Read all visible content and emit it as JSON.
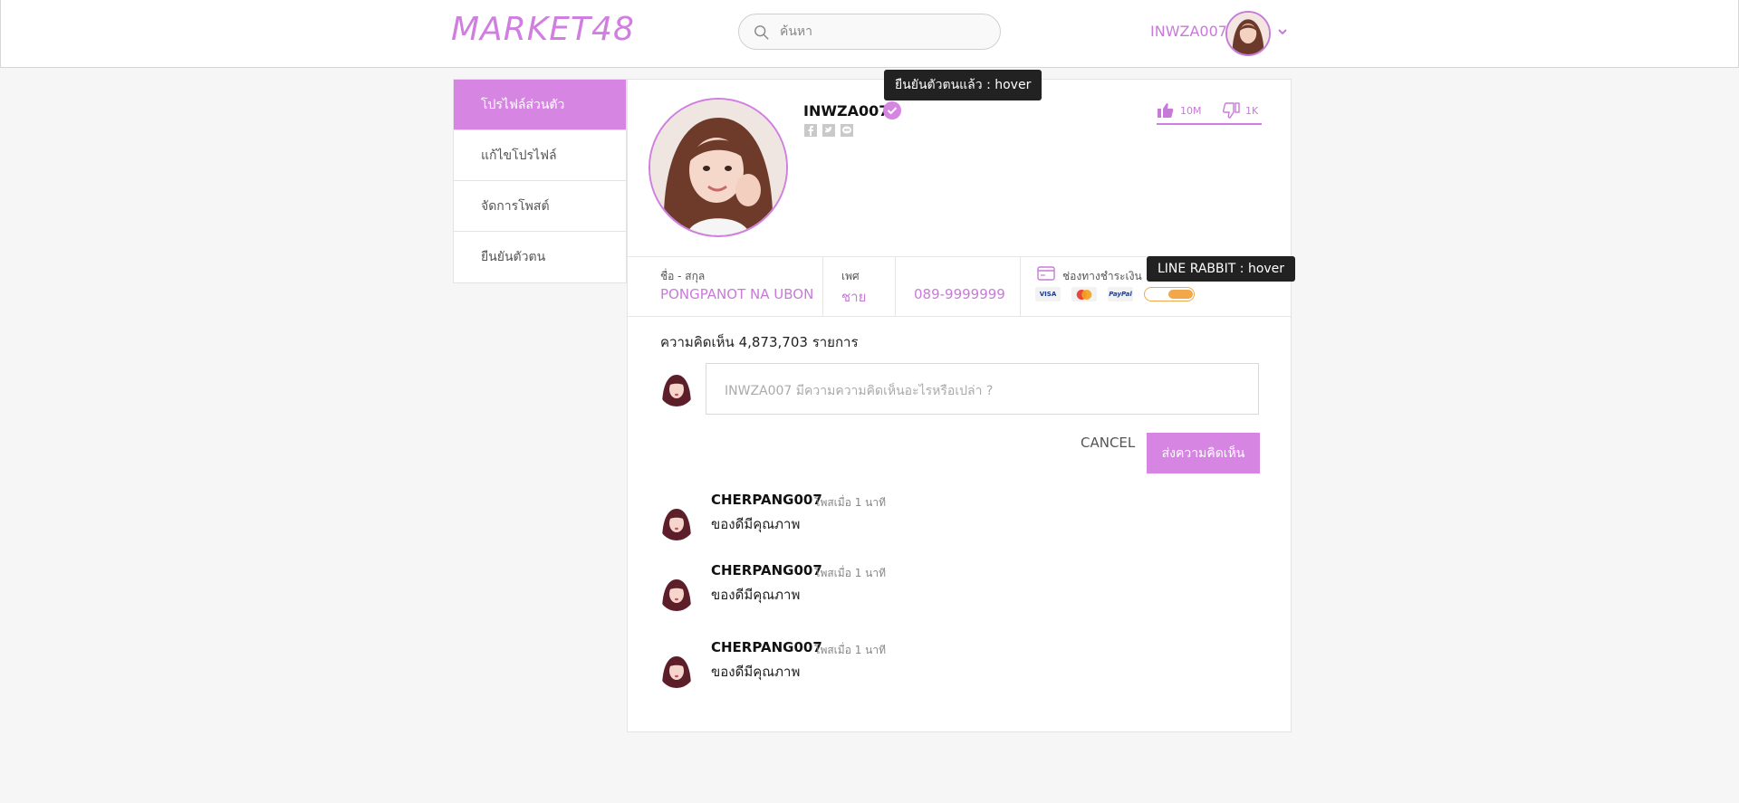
{
  "header": {
    "logo": "MARKET48",
    "search_placeholder": "ค้นหา",
    "username": "INWZA007"
  },
  "sidebar": {
    "items": [
      {
        "label": "โปรไฟล์ส่วนตัว",
        "active": true
      },
      {
        "label": "แก้ไขโปรไฟล์",
        "active": false
      },
      {
        "label": "จัดการโพสต์",
        "active": false
      },
      {
        "label": "ยืนยันตัวตน",
        "active": false
      }
    ]
  },
  "profile": {
    "name": "INWZA007",
    "likes": "10M",
    "dislikes": "1K",
    "fullname_label": "ชื่อ - สกุล",
    "fullname": "PONGPANOT NA UBON",
    "gender_label": "เพศ",
    "gender": "ชาย",
    "phone": "089-9999999",
    "payment_label": "ช่องทางชำระเงิน",
    "payment_methods": [
      "VISA",
      "MasterCard",
      "PayPal",
      "Rabbit LINE Pay"
    ]
  },
  "comments": {
    "count_text": "ความคิดเห็น 4,873,703 รายการ",
    "input_placeholder": "INWZA007 มีความความคิดเห็นอะไรหรือเปล่า ?",
    "cancel_label": "CANCEL",
    "submit_label": "ส่งความคิดเห็น",
    "items": [
      {
        "user": "CHERPANG007",
        "time": "โพสเมื่อ 1 นาที",
        "text": "ของดีมีคุณภาพ"
      },
      {
        "user": "CHERPANG007",
        "time": "โพสเมื่อ 1 นาที",
        "text": "ของดีมีคุณภาพ"
      },
      {
        "user": "CHERPANG007",
        "time": "โพสเมื่อ 1 นาที",
        "text": "ของดีมีคุณภาพ"
      }
    ]
  },
  "tooltips": {
    "verified": "ยืนยันตัวตนแล้ว : hover",
    "line_rabbit": "LINE RABBIT : hover"
  },
  "colors": {
    "accent": "#d785e3",
    "accent_text": "#c87ad8"
  }
}
